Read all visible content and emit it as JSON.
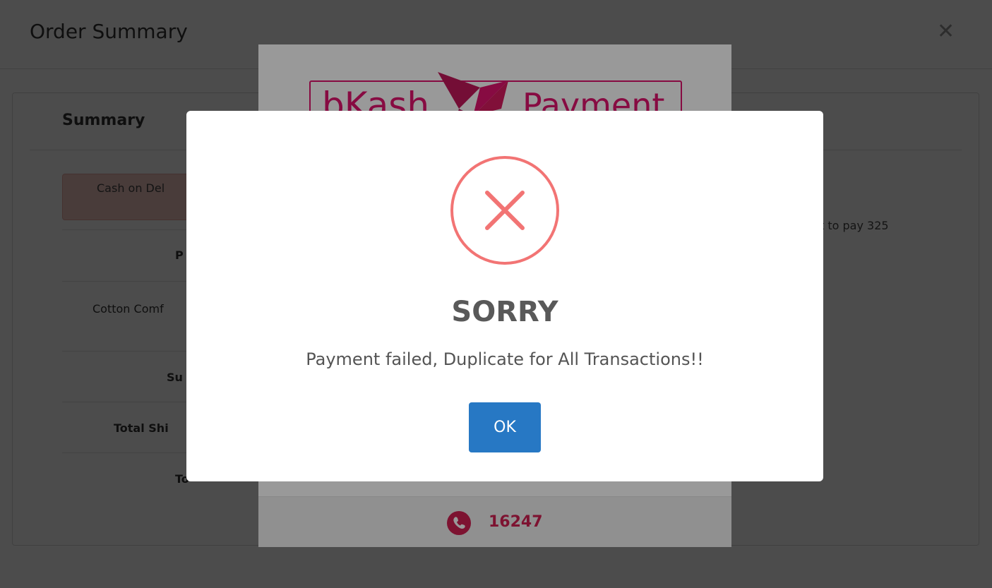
{
  "order_modal": {
    "title": "Order Summary",
    "close_glyph": "✕",
    "summary_heading": "Summary",
    "payment_method": "Cash on Del",
    "rows": [
      "P",
      "Cotton Comf",
      "Su",
      "Total Shi",
      "To"
    ],
    "right_note": "t to pay 325"
  },
  "bkash": {
    "logo_word": "bKash",
    "logo_payment": "Payment",
    "helpline": "16247",
    "icons": {
      "logo": "origami-bird-icon",
      "phone": "phone-icon"
    },
    "brand_color": "#e2136e",
    "accent_color": "#d12053"
  },
  "alert": {
    "title": "SORRY",
    "message": "Payment failed, Duplicate for All Transactions!!",
    "ok_label": "OK",
    "icon": "error-x-icon",
    "icon_color": "#f27474",
    "button_color": "#2778c4"
  }
}
